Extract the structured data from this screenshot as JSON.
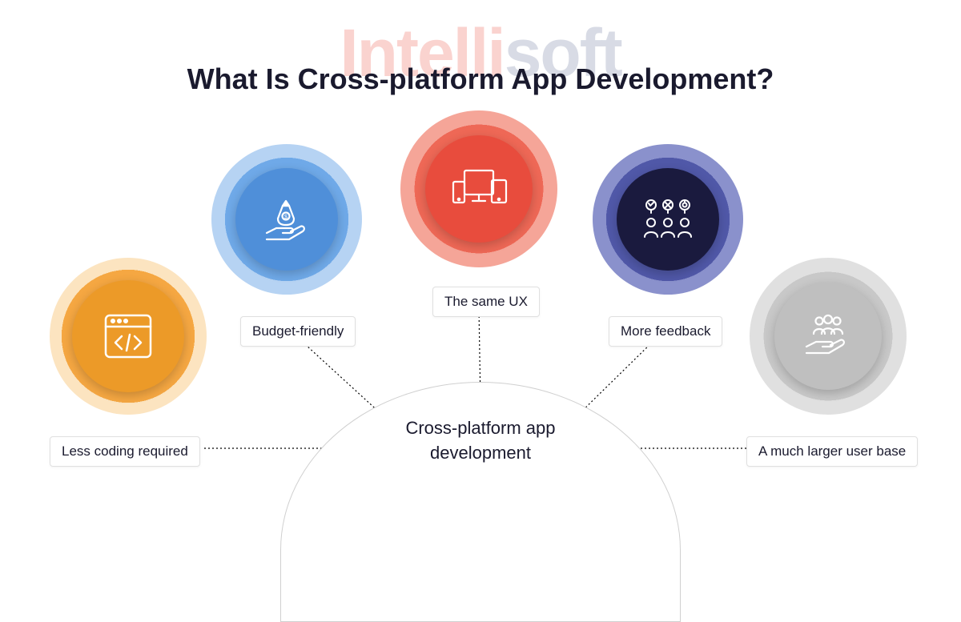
{
  "watermark": {
    "part1": "Intelli",
    "part2": "soft"
  },
  "title": "What Is Cross-platform App Development?",
  "hub": "Cross-platform app development",
  "nodes": [
    {
      "id": "less-coding",
      "label": "Less coding required",
      "icon": "code-window",
      "color": "#ec9a28"
    },
    {
      "id": "budget",
      "label": "Budget-friendly",
      "icon": "money-hand",
      "color": "#4f8fd9"
    },
    {
      "id": "same-ux",
      "label": "The same UX",
      "icon": "devices",
      "color": "#e84c3d"
    },
    {
      "id": "feedback",
      "label": "More feedback",
      "icon": "people-feedback",
      "color": "#1a1a3e"
    },
    {
      "id": "user-base",
      "label": "A much larger user base",
      "icon": "users-hand",
      "color": "#bfbfbf"
    }
  ]
}
